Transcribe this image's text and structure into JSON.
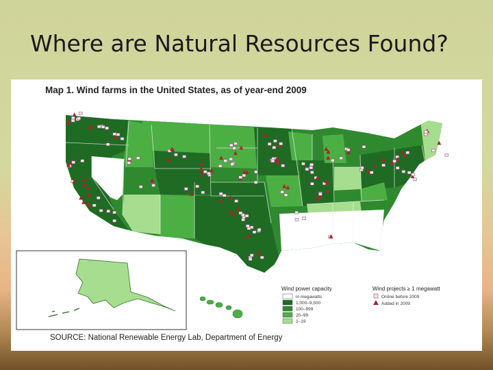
{
  "slide": {
    "title": "Where are Natural Resources Found?"
  },
  "map": {
    "title": "Map 1. Wind farms in the United States, as of year-end 2009",
    "source": "SOURCE: National Renewable Energy Lab, Department of Energy",
    "colors": {
      "darkest": "#1f6b24",
      "dark": "#2f8a2f",
      "medium": "#4caf44",
      "light": "#a7dd8f",
      "none": "#ffffff",
      "existing_marker": "#f2e6ef",
      "added_marker": "#a3282a"
    },
    "legend": {
      "capacity": {
        "heading": "Wind power capacity",
        "items": [
          {
            "label": "in megawatts",
            "color": "#ffffff"
          },
          {
            "label": "1,000–9,500",
            "color": "#1f6b24"
          },
          {
            "label": "100–999",
            "color": "#2f8a2f"
          },
          {
            "label": "20–99",
            "color": "#4caf44"
          },
          {
            "label": "1–19",
            "color": "#a7dd8f"
          }
        ]
      },
      "projects": {
        "heading": "Wind projects ≥ 1 megawatt",
        "items": [
          {
            "label": "Online before 2009",
            "marker": "square"
          },
          {
            "label": "Added in 2009",
            "marker": "triangle"
          }
        ]
      }
    }
  }
}
